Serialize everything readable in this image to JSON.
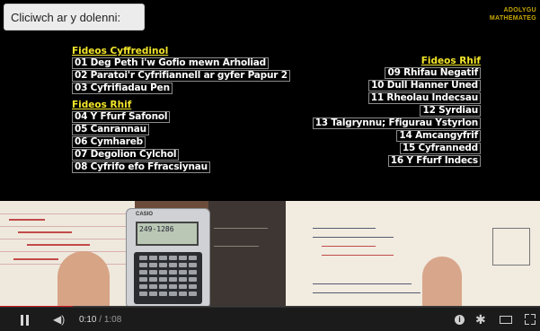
{
  "hint": "Cliciwch ar y dolenni:",
  "brand": [
    "ADOLYGU",
    "MATHEMATEG"
  ],
  "left_column": {
    "groups": [
      {
        "heading": "Fideos Cyffredinol",
        "links": [
          "01 Deg Peth i'w Gofio mewn Arholiad",
          "02 Paratoi'r Cyfrifiannell ar gyfer Papur 2",
          "03 Cyfrifiadau Pen"
        ]
      },
      {
        "heading": "Fideos Rhif",
        "links": [
          "04 Y Ffurf Safonol",
          "05 Canrannau",
          "06 Cymhareb",
          "07 Degolion Cylchol",
          "08 Cyfrifo efo Ffracsiynau"
        ]
      }
    ]
  },
  "right_column": {
    "heading": "Fideos Rhif",
    "links": [
      "09 Rhifau Negatif",
      "10 Dull Hanner Uned",
      "11 Rheolau Indecsau",
      "12 Syrdiau",
      "13 Talgrynnu; Ffigurau Ystyrlon",
      "14 Amcangyfrif",
      "15 Cyfrannedd",
      "16 Y Ffurf Indecs"
    ]
  },
  "calculator": {
    "brand": "CASIO",
    "display": "249-1286"
  },
  "player": {
    "progress_fraction": 0.135,
    "current_time": "0:10",
    "separator": " / ",
    "duration": "1:08",
    "accent_color": "#cc181e",
    "icons": [
      "pause-icon",
      "volume-icon",
      "info-icon",
      "settings-gear-icon",
      "theater-mode-icon",
      "fullscreen-icon"
    ]
  }
}
